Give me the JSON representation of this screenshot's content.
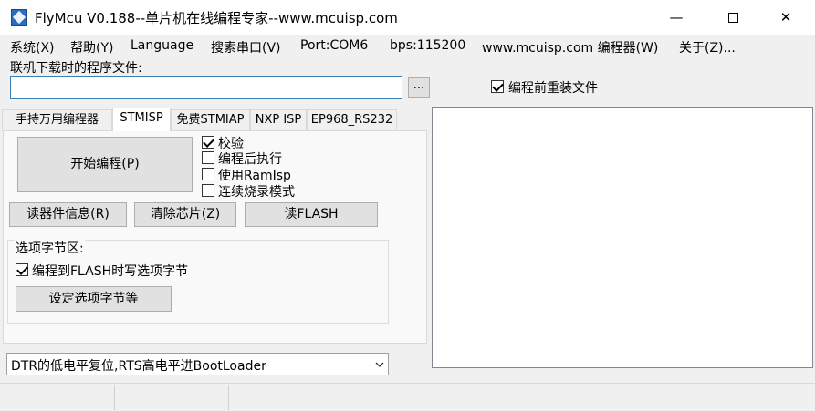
{
  "window": {
    "title": "FlyMcu V0.188--单片机在线编程专家--www.mcuisp.com",
    "minimize": "—",
    "close": "✕"
  },
  "menu": {
    "items": [
      "系统(X)",
      "帮助(Y)",
      "Language",
      "搜索串口(V)",
      "Port:COM6",
      "bps:115200",
      "www.mcuisp.com 编程器(W)",
      "关于(Z)..."
    ]
  },
  "file": {
    "label": "联机下载时的程序文件:",
    "value": "",
    "browse_label": "...",
    "reload_label": "编程前重装文件",
    "reload_checked": true
  },
  "tabs": [
    {
      "label": "手持万用编程器",
      "active": false
    },
    {
      "label": "STMISP",
      "active": true
    },
    {
      "label": "免费STMIAP",
      "active": false
    },
    {
      "label": "NXP ISP",
      "active": false
    },
    {
      "label": "EP968_RS232",
      "active": false
    }
  ],
  "stmisp": {
    "start_button": "开始编程(P)",
    "checks": [
      {
        "label": "校验",
        "checked": true
      },
      {
        "label": "编程后执行",
        "checked": false
      },
      {
        "label": "使用RamIsp",
        "checked": false
      },
      {
        "label": "连续烧录模式",
        "checked": false
      }
    ],
    "read_info_button": "读器件信息(R)",
    "erase_button": "清除芯片(Z)",
    "read_flash_button": "读FLASH",
    "option_group_title": "选项字节区:",
    "write_option_label": "编程到FLASH时写选项字节",
    "write_option_checked": true,
    "set_option_button": "设定选项字节等"
  },
  "bootloader_select": {
    "value": "DTR的低电平复位,RTS高电平进BootLoader"
  },
  "colors": {
    "accent_border": "#3c7fb1",
    "window_bg": "#f0f0f0",
    "panel_bg": "#f9f9f9"
  }
}
